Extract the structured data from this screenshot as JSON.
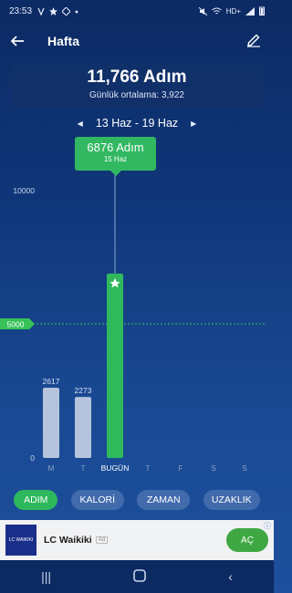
{
  "status_bar": {
    "time": "23:53",
    "network": "HD+"
  },
  "app_bar": {
    "title": "Hafta"
  },
  "summary": {
    "total": "11,766 Adım",
    "average": "Günlük ortalama:  3,922"
  },
  "range": {
    "label": "13 Haz - 19 Haz"
  },
  "tooltip": {
    "value": "6876 Adım",
    "date": "15 Haz"
  },
  "chart_data": {
    "type": "bar",
    "categories": [
      "M",
      "T",
      "BUGÜN",
      "T",
      "F",
      "S",
      "S"
    ],
    "values": [
      2617,
      2273,
      6876,
      0,
      0,
      0,
      0
    ],
    "value_labels": [
      "2617",
      "2273",
      "",
      "",
      "",
      "",
      ""
    ],
    "ylim": [
      0,
      10000
    ],
    "y_ticks": [
      "0",
      "10000"
    ],
    "goal_line": {
      "value": 5000,
      "label": "5000"
    },
    "selected_index": 2,
    "colors": {
      "past": "#b6c3dc",
      "selected": "#2fb95c",
      "goal": "#36c257"
    }
  },
  "tabs": [
    {
      "label": "ADIM",
      "active": true
    },
    {
      "label": "KALORİ",
      "active": false
    },
    {
      "label": "ZAMAN",
      "active": false
    },
    {
      "label": "UZAKLIK",
      "active": false
    }
  ],
  "ad": {
    "logo_text": "LC WAIKIKI",
    "name": "LC Waikiki",
    "tag": "Ad",
    "cta": "AÇ"
  }
}
